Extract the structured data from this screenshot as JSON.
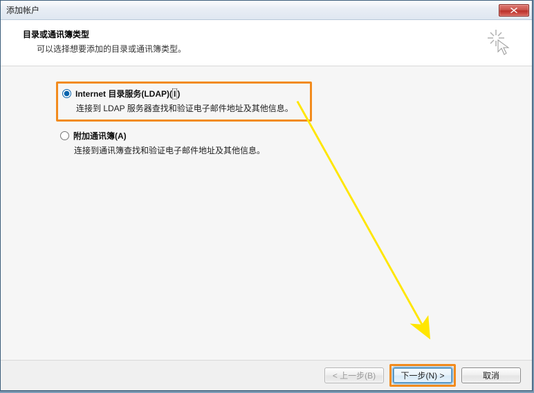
{
  "window": {
    "title": "添加帐户"
  },
  "header": {
    "title": "目录或通讯簿类型",
    "subtitle": "可以选择想要添加的目录或通讯簿类型。"
  },
  "options": {
    "opt1": {
      "label_prefix": "Internet 目录服务(LDAP)(",
      "label_key": "I",
      "label_suffix": ")",
      "description": "连接到 LDAP 服务器查找和验证电子邮件地址及其他信息。",
      "selected": true
    },
    "opt2": {
      "label": "附加通讯簿(A)",
      "description": "连接到通讯簿查找和验证电子邮件地址及其他信息。",
      "selected": false
    }
  },
  "footer": {
    "back": "< 上一步(B)",
    "next": "下一步(N) >",
    "cancel": "取消"
  }
}
